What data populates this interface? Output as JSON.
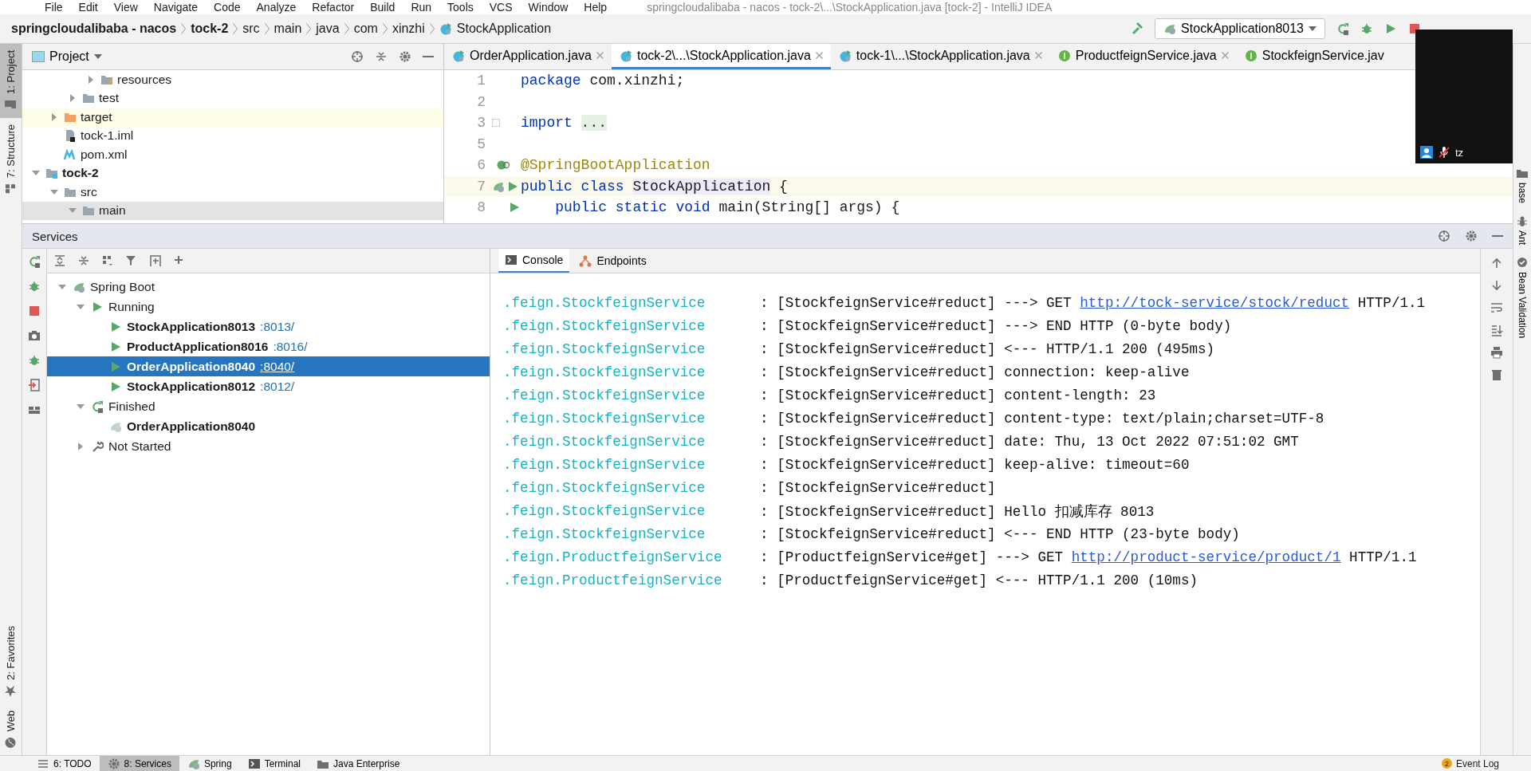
{
  "menu": {
    "items": [
      "File",
      "Edit",
      "View",
      "Navigate",
      "Code",
      "Analyze",
      "Refactor",
      "Build",
      "Run",
      "Tools",
      "VCS",
      "Window",
      "Help"
    ],
    "title": "springcloudalibaba - nacos - tock-2\\...\\StockApplication.java [tock-2] - IntelliJ IDEA"
  },
  "breadcrumbs": [
    {
      "label": "springcloudalibaba - nacos",
      "bold": true
    },
    {
      "label": "tock-2",
      "bold": true
    },
    {
      "label": "src",
      "bold": false
    },
    {
      "label": "main",
      "bold": false
    },
    {
      "label": "java",
      "bold": false
    },
    {
      "label": "com",
      "bold": false
    },
    {
      "label": "xinzhi",
      "bold": false
    },
    {
      "label": "StockApplication",
      "bold": false,
      "kind": "class"
    }
  ],
  "run_config": {
    "label": "StockApplication8013"
  },
  "left_strip": {
    "top": [
      {
        "label": "1: Project",
        "selected": true
      },
      {
        "label": "7: Structure",
        "selected": false
      }
    ],
    "bottom": [
      {
        "label": "2: Favorites",
        "selected": false
      },
      {
        "label": "Web",
        "selected": false
      }
    ]
  },
  "right_strip": [
    {
      "label": "base"
    },
    {
      "label": "Ant"
    },
    {
      "label": "Bean Validation"
    }
  ],
  "project": {
    "title": "Project",
    "tree": [
      {
        "children": [
          {
            "children": [
              {
                "children": [
                  {
                    "label": "resources",
                    "kind": "resources",
                    "expanded": false,
                    "selected": false
                  }
                ]
              },
              {
                "label": "test",
                "kind": "folder",
                "expanded": false,
                "selected": false
              }
            ]
          },
          {
            "label": "target",
            "kind": "excluded",
            "expanded": false,
            "selected": false,
            "highlighted": true
          },
          {
            "label": "tock-1.iml",
            "kind": "iml",
            "selected": false
          },
          {
            "label": "pom.xml",
            "kind": "maven",
            "selected": false
          }
        ]
      },
      {
        "label": "tock-2",
        "kind": "module",
        "bold": true,
        "expanded": true,
        "selected": false,
        "children": [
          {
            "label": "src",
            "kind": "folder",
            "expanded": true,
            "selected": false,
            "children": [
              {
                "label": "main",
                "kind": "folder",
                "expanded": true,
                "selected": true
              }
            ]
          }
        ]
      }
    ]
  },
  "editor": {
    "tabs": [
      {
        "label": "OrderApplication.java",
        "kind": "class",
        "selected": false,
        "closable": true
      },
      {
        "label": "tock-2\\...\\StockApplication.java",
        "kind": "class",
        "selected": true,
        "closable": true
      },
      {
        "label": "tock-1\\...\\StockApplication.java",
        "kind": "class",
        "selected": false,
        "closable": true
      },
      {
        "label": "ProductfeignService.java",
        "kind": "interface",
        "selected": false,
        "closable": true
      },
      {
        "label": "StockfeignService.jav",
        "kind": "interface",
        "selected": false,
        "closable": false
      }
    ],
    "lines": [
      {
        "number": "1",
        "current": false,
        "kind": "plain",
        "tokens": [
          {
            "kind": "keyword",
            "text": "package"
          },
          {
            "kind": "plain",
            "text": "com.xinzhi;"
          }
        ]
      },
      {
        "number": "2",
        "current": false,
        "kind": "plain"
      },
      {
        "number": "3",
        "current": false,
        "fold": true,
        "kind": "plain",
        "tokens": [
          {
            "kind": "keyword",
            "text": "import"
          },
          {
            "kind": "folded",
            "text": "..."
          }
        ]
      },
      {
        "number": "5",
        "current": false,
        "kind": "plain"
      },
      {
        "number": "6",
        "current": false,
        "kind": "bean",
        "tokens": [
          {
            "kind": "annotation",
            "text": "@SpringBootApplication"
          }
        ]
      },
      {
        "number": "7",
        "current": true,
        "kind": "run-class",
        "tokens": [
          {
            "kind": "keyword",
            "text": "public class"
          },
          {
            "kind": "usage",
            "text": "StockApplication"
          },
          {
            "kind": "plain",
            "text": "{"
          }
        ]
      },
      {
        "number": "8",
        "current": false,
        "kind": "run-method",
        "tokens": [
          {
            "kind": "keyword",
            "text": "    public static void"
          },
          {
            "kind": "plain",
            "text": "main(String[] args) {"
          }
        ]
      }
    ]
  },
  "webcam": {
    "name": "tz"
  },
  "services": {
    "title": "Services",
    "tree": [
      {
        "label": "Spring Boot",
        "kind": "spring",
        "expanded": true,
        "selected": false,
        "children": [
          {
            "label": "Running",
            "kind": "running",
            "expanded": true,
            "selected": false,
            "children": [
              {
                "label": "StockApplication8013",
                "port": ":8013/",
                "kind": "app",
                "selected": false
              },
              {
                "label": "ProductApplication8016",
                "port": ":8016/",
                "kind": "app",
                "selected": false
              },
              {
                "label": "OrderApplication8040",
                "port": ":8040/",
                "kind": "app",
                "selected": true
              },
              {
                "label": "StockApplication8012",
                "port": ":8012/",
                "kind": "app",
                "selected": false
              }
            ]
          },
          {
            "label": "Finished",
            "kind": "finished",
            "expanded": true,
            "selected": false,
            "children": [
              {
                "label": "OrderApplication8040",
                "kind": "stopped-app",
                "selected": false
              }
            ]
          },
          {
            "label": "Not Started",
            "kind": "not-started",
            "expanded": false,
            "selected": false
          }
        ]
      }
    ],
    "tabs": [
      {
        "label": "Console",
        "kind": "console",
        "selected": true
      },
      {
        "label": "Endpoints",
        "kind": "endpoints",
        "selected": false
      }
    ],
    "console": [
      {
        "logger": ".feign.StockfeignService",
        "separator": ":",
        "message": "[StockfeignService#reduct] ---> GET ",
        "link": "http://tock-service/stock/reduct",
        "tail": " HTTP/1.1"
      },
      {
        "logger": ".feign.StockfeignService",
        "separator": ":",
        "message": "[StockfeignService#reduct] ---> END HTTP (0-byte body)"
      },
      {
        "logger": ".feign.StockfeignService",
        "separator": ":",
        "message": "[StockfeignService#reduct] <--- HTTP/1.1 200 (495ms)"
      },
      {
        "logger": ".feign.StockfeignService",
        "separator": ":",
        "message": "[StockfeignService#reduct] connection: keep-alive"
      },
      {
        "logger": ".feign.StockfeignService",
        "separator": ":",
        "message": "[StockfeignService#reduct] content-length: 23"
      },
      {
        "logger": ".feign.StockfeignService",
        "separator": ":",
        "message": "[StockfeignService#reduct] content-type: text/plain;charset=UTF-8"
      },
      {
        "logger": ".feign.StockfeignService",
        "separator": ":",
        "message": "[StockfeignService#reduct] date: Thu, 13 Oct 2022 07:51:02 GMT"
      },
      {
        "logger": ".feign.StockfeignService",
        "separator": ":",
        "message": "[StockfeignService#reduct] keep-alive: timeout=60"
      },
      {
        "logger": ".feign.StockfeignService",
        "separator": ":",
        "message": "[StockfeignService#reduct]"
      },
      {
        "logger": ".feign.StockfeignService",
        "separator": ":",
        "message": "[StockfeignService#reduct] Hello 扣减库存 8013"
      },
      {
        "logger": ".feign.StockfeignService",
        "separator": ":",
        "message": "[StockfeignService#reduct] <--- END HTTP (23-byte body)"
      },
      {
        "logger": ".feign.ProductfeignService",
        "separator": ":",
        "message": "[ProductfeignService#get] ---> GET ",
        "link": "http://product-service/product/1",
        "tail": " HTTP/1.1"
      },
      {
        "logger": ".feign.ProductfeignService",
        "separator": ":",
        "message": "[ProductfeignService#get] <--- HTTP/1.1 200 (10ms)"
      }
    ]
  },
  "bottom_bar": {
    "tabs": [
      {
        "label": "6: TODO",
        "selected": false
      },
      {
        "label": "8: Services",
        "selected": true
      },
      {
        "label": "Spring",
        "selected": false
      },
      {
        "label": "Terminal",
        "selected": false
      },
      {
        "label": "Java Enterprise",
        "selected": false
      }
    ],
    "event_log": {
      "label": "Event Log",
      "badge": "2"
    }
  }
}
